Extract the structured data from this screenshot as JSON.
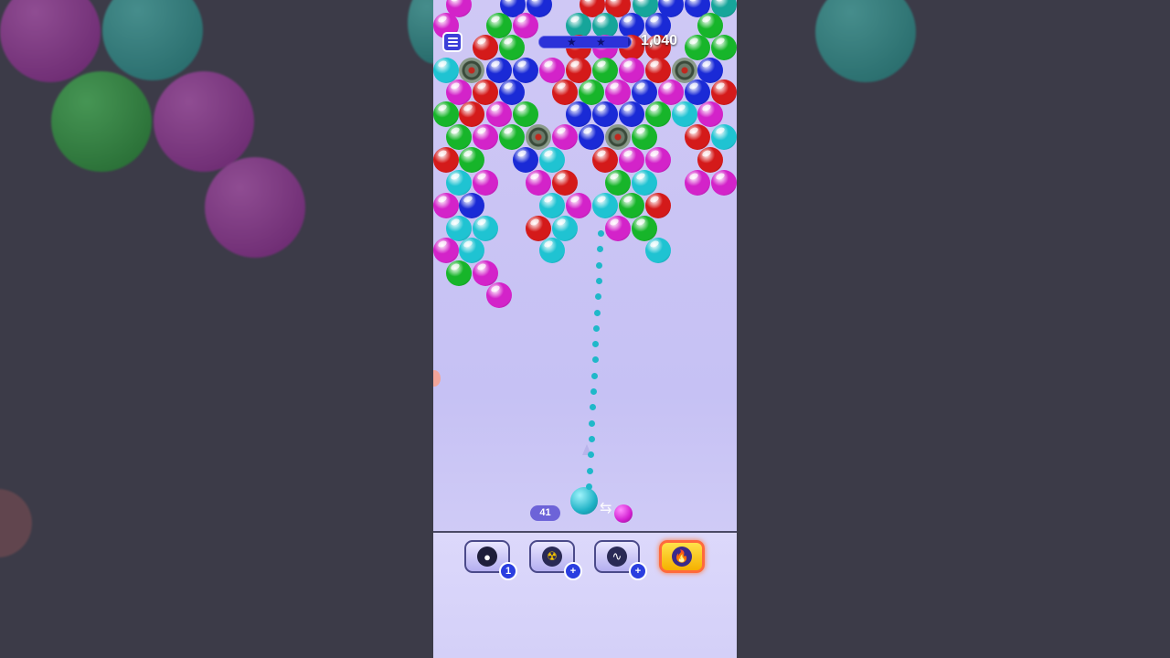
{
  "score": "1,040",
  "shots_remaining": "41",
  "progress_fraction": 0.97,
  "colors": {
    "red": "#d41a1a",
    "green": "#17b52a",
    "blue": "#1a2ad6",
    "cyan": "#1fc3d2",
    "magenta": "#d323c9",
    "teal": "#16a59a",
    "bomb": "#5a6a5a",
    "phone_bg": "#c9c3f4",
    "side_bg": "#3c3b48"
  },
  "icons": {
    "menu": "hamburger-icon",
    "powerup_1": "bomb-icon",
    "powerup_2": "radiation-icon",
    "powerup_3": "wave-icon",
    "powerup_4": "fire-icon"
  },
  "powerups": [
    {
      "name": "bomb",
      "badge": "1"
    },
    {
      "name": "radiation",
      "badge": "+"
    },
    {
      "name": "wave",
      "badge": "+"
    },
    {
      "name": "fire",
      "badge": ""
    }
  ],
  "launcher_color": "cyan",
  "next_color": "magenta"
}
